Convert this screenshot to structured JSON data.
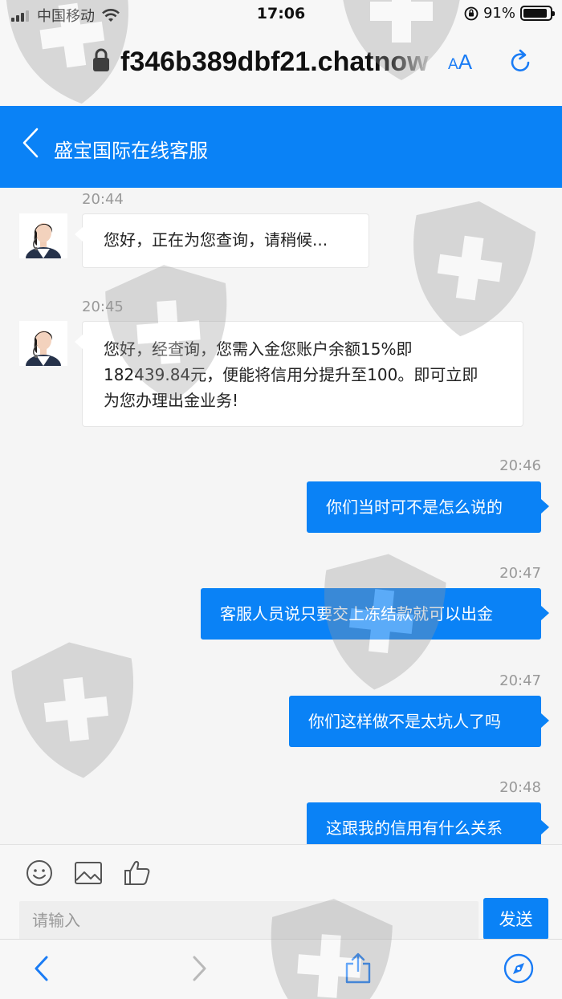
{
  "status_bar": {
    "carrier": "中国移动",
    "time": "17:06",
    "battery": "91%",
    "battery_level": 0.91
  },
  "browser": {
    "url": "f346b389dbf21.chatnow",
    "text_size_label_small": "A",
    "text_size_label_large": "A"
  },
  "chat": {
    "title": "盛宝国际在线客服",
    "messages": [
      {
        "time": "20:44",
        "from": "agent",
        "text": "您好，正在为您查询，请稍候..."
      },
      {
        "time": "20:45",
        "from": "agent",
        "lines": [
          "您好，经查询，您需入金您账户余额15%即",
          "182439.84元，便能将信用分提升至100。即可立即",
          "为您办理出金业务!"
        ]
      },
      {
        "time": "20:46",
        "from": "user",
        "text": "你们当时可不是怎么说的"
      },
      {
        "time": "20:47",
        "from": "user",
        "text": "客服人员说只要交上冻结款就可以出金"
      },
      {
        "time": "20:47",
        "from": "user",
        "text": "你们这样做不是太坑人了吗"
      },
      {
        "time": "20:48",
        "from": "user",
        "text": "这跟我的信用有什么关系"
      }
    ]
  },
  "composer": {
    "placeholder": "请输入",
    "send_label": "发送"
  },
  "colors": {
    "accent": "#0a82f6",
    "safari_blue": "#1a7cf5"
  }
}
